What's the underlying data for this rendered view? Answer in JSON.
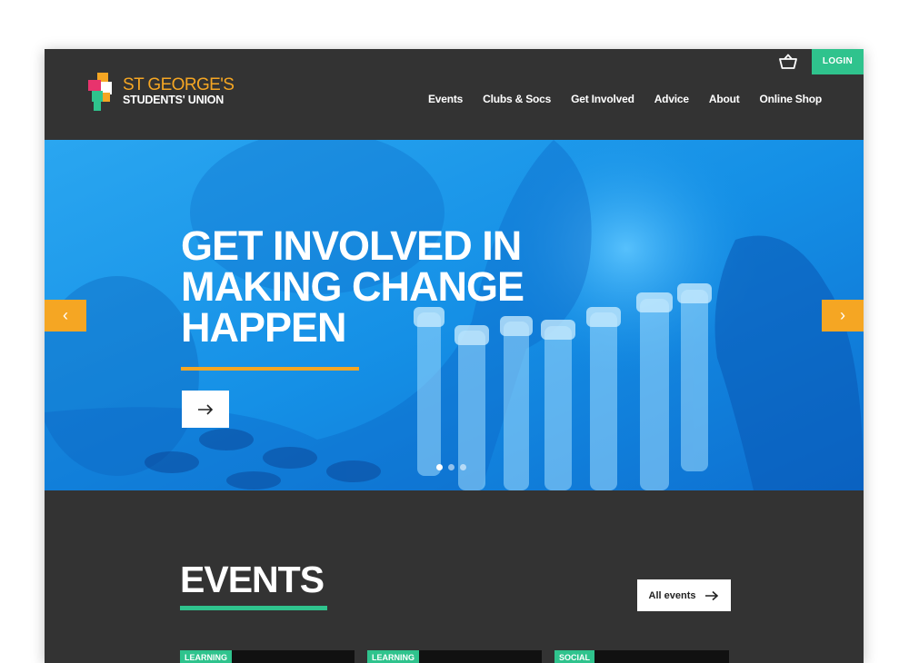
{
  "header": {
    "logo": {
      "line1": "ST GEORGE'S",
      "line2": "STUDENTS' UNION"
    },
    "login_label": "LOGIN",
    "basket_icon": "basket-icon",
    "nav": [
      {
        "label": "Events"
      },
      {
        "label": "Clubs & Socs"
      },
      {
        "label": "Get Involved"
      },
      {
        "label": "Advice"
      },
      {
        "label": "About"
      },
      {
        "label": "Online Shop"
      }
    ]
  },
  "hero": {
    "headline": [
      "GET INVOLVED IN",
      "MAKING CHANGE",
      "HAPPEN"
    ],
    "prev_label": "‹",
    "next_label": "›",
    "slides_count": 3,
    "active_slide": 1
  },
  "events": {
    "title": "EVENTS",
    "all_events_label": "All events",
    "cards": [
      {
        "tag": "LEARNING"
      },
      {
        "tag": "LEARNING"
      },
      {
        "tag": "SOCIAL"
      }
    ]
  },
  "colors": {
    "accent_green": "#2fc38d",
    "accent_orange": "#f5a623",
    "header_bg": "#333333",
    "hero_blue": "#1a8fe0"
  }
}
